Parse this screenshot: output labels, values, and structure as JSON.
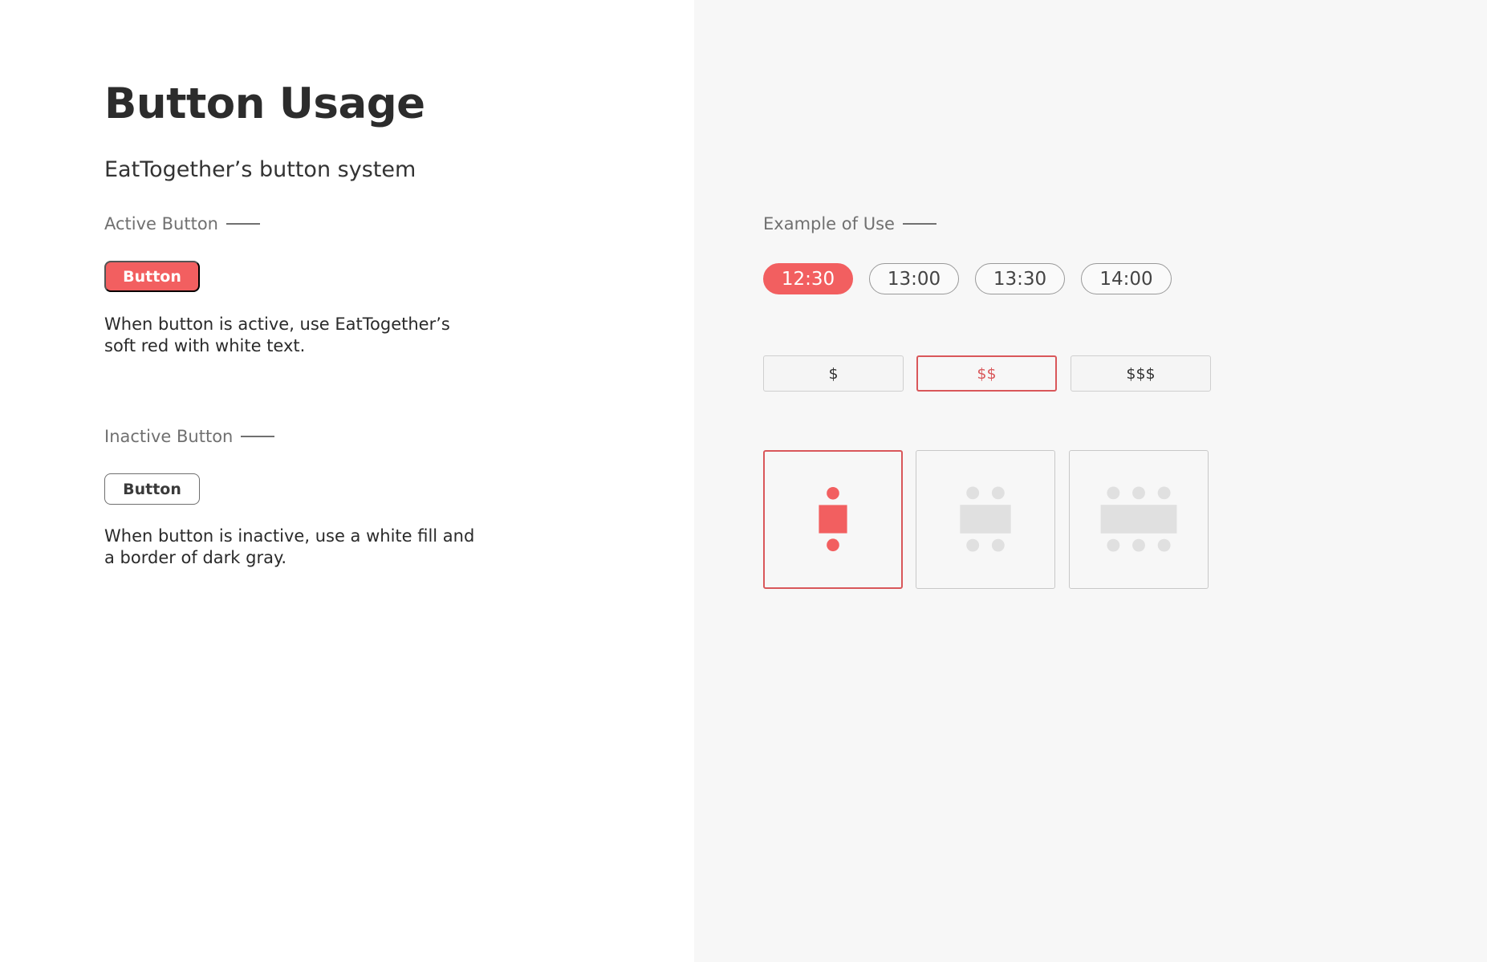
{
  "title": "Button Usage",
  "subtitle": "EatTogether’s button system",
  "active_section": {
    "label": "Active Button",
    "button_label": "Button",
    "description_lines": [
      "When button is active, use EatTogether’s",
      "soft red with white text."
    ]
  },
  "inactive_section": {
    "label": "Inactive Button",
    "button_label": "Button",
    "description_lines": [
      "When button is inactive, use a white fill and",
      "a border of dark gray."
    ]
  },
  "example": {
    "label": "Example of Use",
    "times": [
      {
        "label": "12:30",
        "active": true
      },
      {
        "label": "13:00",
        "active": false
      },
      {
        "label": "13:30",
        "active": false
      },
      {
        "label": "14:00",
        "active": false
      }
    ],
    "prices": [
      {
        "label": "$",
        "active": false
      },
      {
        "label": "$$",
        "active": true
      },
      {
        "label": "$$$",
        "active": false
      }
    ],
    "table_options": [
      {
        "icon": "two-person-table-icon",
        "seats": 2,
        "active": true
      },
      {
        "icon": "four-person-table-icon",
        "seats": 4,
        "active": false
      },
      {
        "icon": "six-person-table-icon",
        "seats": 6,
        "active": false
      }
    ]
  },
  "colors": {
    "soft_red": "#f25f60",
    "active_border": "#d9575a",
    "inactive_border": "#6f6f6f",
    "panel_bg": "#f7f7f7",
    "inactive_icon": "#e0e0e0"
  }
}
